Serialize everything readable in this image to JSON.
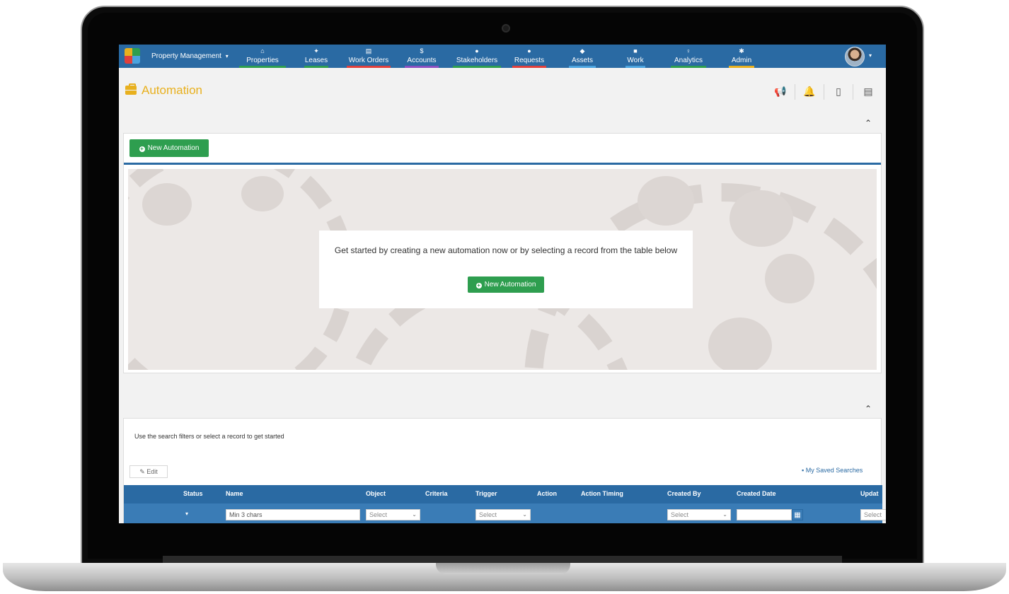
{
  "app": {
    "brand": "Property Management",
    "brand_caret": "▾"
  },
  "nav": {
    "items": [
      {
        "label": "Properties",
        "icon": "home-icon",
        "glyph": "⌂",
        "underline": "#2e9e4f"
      },
      {
        "label": "Leases",
        "icon": "handshake-icon",
        "glyph": "✦",
        "underline": "#2e9e4f"
      },
      {
        "label": "Work Orders",
        "icon": "clipboard-icon",
        "glyph": "▤",
        "underline": "#e0403c"
      },
      {
        "label": "Accounts",
        "icon": "money-icon",
        "glyph": "$",
        "underline": "#8b4fc0"
      },
      {
        "label": "Stakeholders",
        "icon": "person-icon",
        "glyph": "●",
        "underline": "#2e9e4f"
      },
      {
        "label": "Requests",
        "icon": "chat-icon",
        "glyph": "●",
        "underline": "#e0403c"
      },
      {
        "label": "Assets",
        "icon": "tag-icon",
        "glyph": "◆",
        "underline": "#4aa3df"
      },
      {
        "label": "Work",
        "icon": "briefcase-icon",
        "glyph": "■",
        "underline": "#4aa3df"
      },
      {
        "label": "Analytics",
        "icon": "lightbulb-icon",
        "glyph": "♀",
        "underline": "#2e9e4f"
      },
      {
        "label": "Admin",
        "icon": "gear-icon",
        "glyph": "✱",
        "underline": "#e8b01e"
      }
    ]
  },
  "user": {
    "caret": "▾"
  },
  "page": {
    "title": "Automation",
    "tools": [
      {
        "icon": "megaphone-icon",
        "glyph": "📢"
      },
      {
        "icon": "bell-icon",
        "glyph": "🔔"
      },
      {
        "icon": "mobile-icon",
        "glyph": "▯"
      },
      {
        "icon": "document-icon",
        "glyph": "▤"
      }
    ],
    "collapse_glyph": "⌃"
  },
  "automation_panel": {
    "new_button": "New Automation",
    "hero_text": "Get started by creating a new automation now or by selecting a record from the table below",
    "hero_button": "New Automation"
  },
  "results": {
    "hint": "Use the search filters or select a record to get started",
    "edit_button": "Edit",
    "edit_glyph": "✎",
    "saved_searches": "My Saved Searches",
    "saved_glyph": "▪",
    "columns": [
      "Status",
      "Name",
      "Object",
      "Criteria",
      "Trigger",
      "Action",
      "Action Timing",
      "Created By",
      "Created Date",
      "Updat"
    ],
    "filters": {
      "status_caret": "▾",
      "name_placeholder": "Min 3 chars",
      "object": "Select",
      "trigger": "Select",
      "created_by": "Select",
      "updated": "Select",
      "calendar_glyph": "▦"
    }
  },
  "colors": {
    "nav_bg": "#2a6aa3",
    "accent_yellow": "#e8b01e",
    "button_green": "#2e9e4f"
  }
}
